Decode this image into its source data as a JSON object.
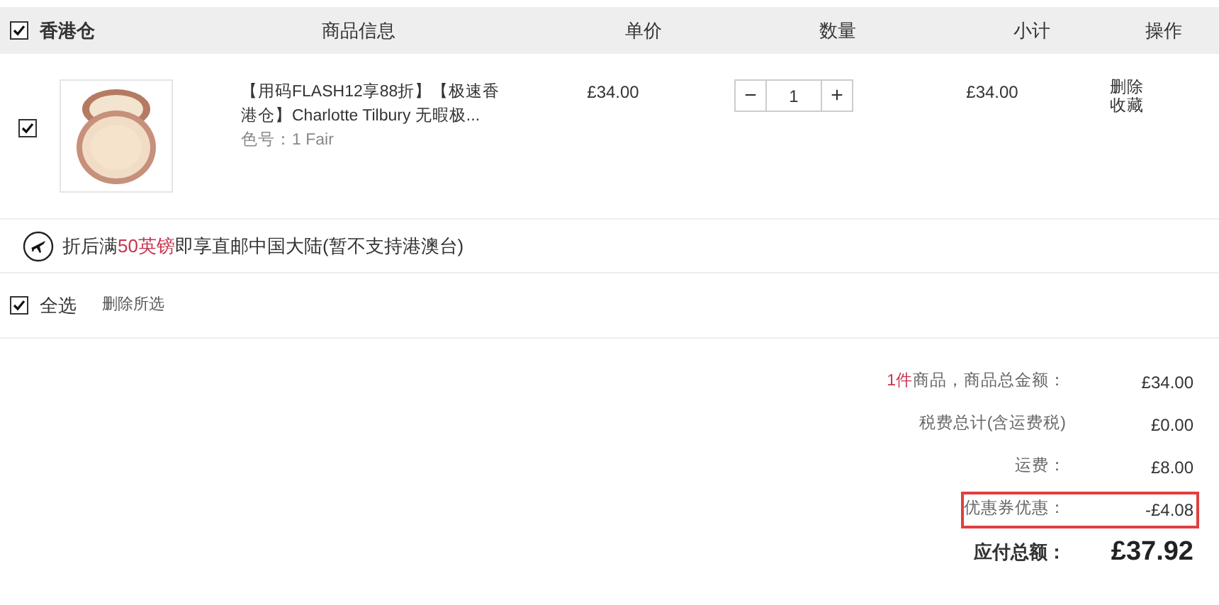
{
  "header": {
    "checked": true,
    "warehouse": "香港仓",
    "columns": [
      "商品信息",
      "单价",
      "数量",
      "小计",
      "操作"
    ]
  },
  "items": [
    {
      "checked": true,
      "title": "【用码FLASH12享88折】【极速香港仓】Charlotte Tilbury 无暇极...",
      "variant": "色号：1 Fair",
      "unit_price": "£34.00",
      "quantity": "1",
      "minus": "−",
      "plus": "+",
      "subtotal": "£34.00",
      "actions": [
        "删除",
        "收藏"
      ]
    }
  ],
  "shipping_notice": [
    {
      "text": "折后满",
      "highlight": false
    },
    {
      "text": "50英镑",
      "highlight": true
    },
    {
      "text": "即享直邮中国大陆(暂不支持港澳台)",
      "highlight": false
    }
  ],
  "select_all": {
    "checked": true,
    "label": "全选",
    "delete_selected": "删除所选"
  },
  "summary": [
    {
      "label": [
        {
          "text": "1件",
          "highlight": true
        },
        {
          "text": "商品，商品总金额：",
          "highlight": false
        }
      ],
      "value": "£34.00",
      "emphasis": false,
      "boxed": false
    },
    {
      "label": [
        {
          "text": "税费总计(含运费税)",
          "highlight": false
        }
      ],
      "value": "£0.00",
      "emphasis": false,
      "boxed": false
    },
    {
      "label": [
        {
          "text": "运费：",
          "highlight": false
        }
      ],
      "value": "£8.00",
      "emphasis": false,
      "boxed": false
    },
    {
      "label": [
        {
          "text": "优惠券优惠：",
          "highlight": false
        }
      ],
      "value": "-£4.08",
      "emphasis": false,
      "boxed": true
    },
    {
      "label": [
        {
          "text": "应付总额：",
          "highlight": false
        }
      ],
      "value": "£37.92",
      "emphasis": true,
      "boxed": false
    }
  ]
}
